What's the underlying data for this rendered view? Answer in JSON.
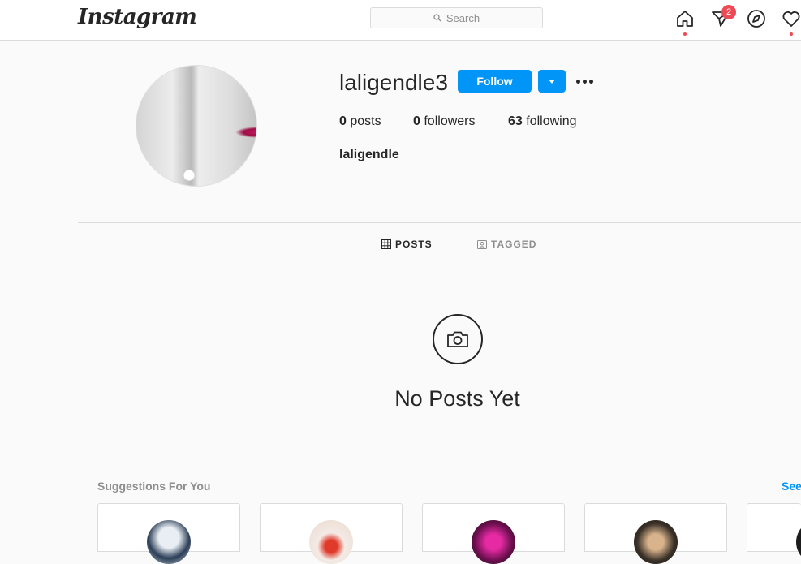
{
  "topbar": {
    "logo": "Instagram",
    "search_placeholder": "Search",
    "notification_badge": "2",
    "icons": [
      "home-icon",
      "direct-icon",
      "explore-icon",
      "activity-icon"
    ]
  },
  "profile": {
    "username": "laligendle3",
    "follow_label": "Follow",
    "stats": {
      "posts_count": "0",
      "posts_label": "posts",
      "followers_count": "0",
      "followers_label": "followers",
      "following_count": "63",
      "following_label": "following"
    },
    "full_name": "laligendle"
  },
  "tabs": [
    {
      "label": "POSTS",
      "active": true
    },
    {
      "label": "TAGGED",
      "active": false
    }
  ],
  "empty_state": {
    "message": "No Posts Yet"
  },
  "suggestions": {
    "title": "Suggestions For You",
    "see_all": "See"
  },
  "colors": {
    "accent": "#0095f6",
    "badge": "#ed4956",
    "text": "#262626",
    "muted": "#8e8e8e",
    "border": "#dbdbdb"
  }
}
